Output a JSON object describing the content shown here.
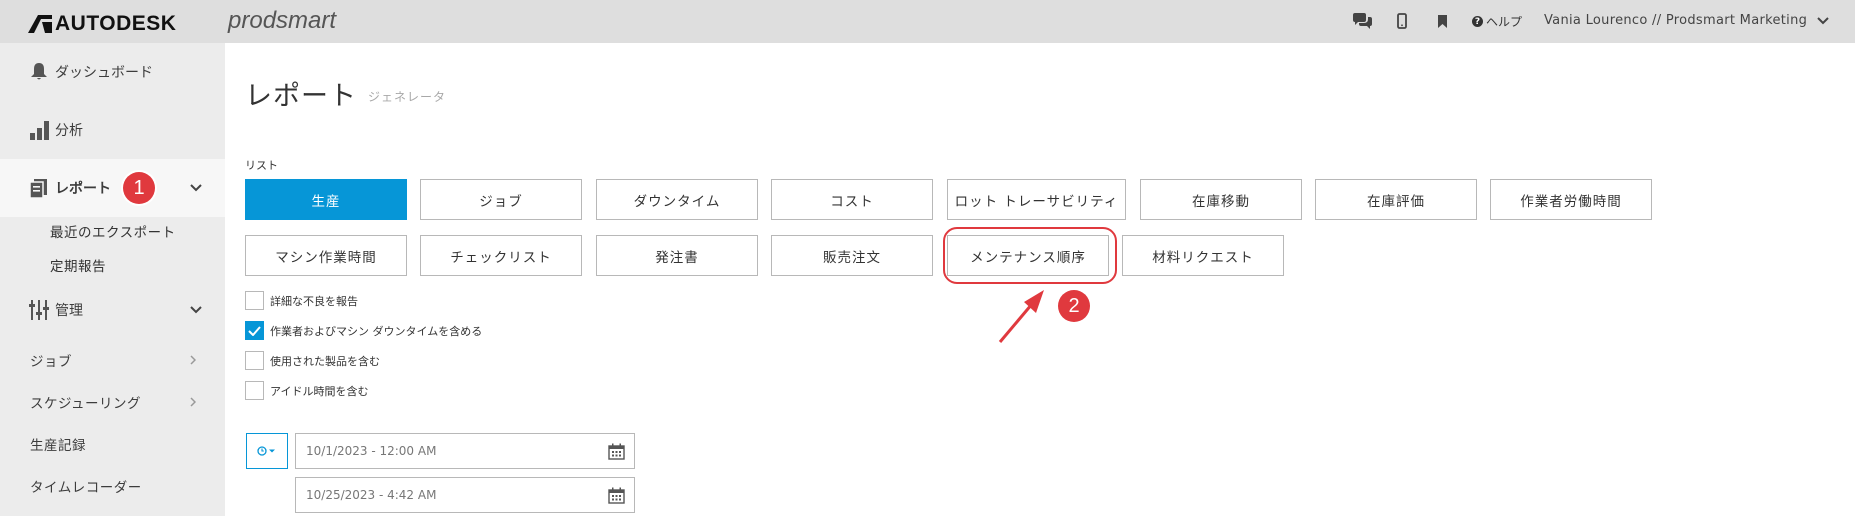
{
  "topbar": {
    "brand": "AUTODESK",
    "product": "prodsmart",
    "help_label": "ヘルプ",
    "user_label": "Vania Lourenco // Prodsmart Marketing",
    "icons": [
      "chat-icon",
      "mobile-icon",
      "bookmark-icon",
      "help-icon",
      "chevron-down-icon"
    ]
  },
  "sidebar": {
    "dashboard": "ダッシュボード",
    "analysis": "分析",
    "reports": "レポート",
    "reports_badge": "1",
    "recent_exports": "最近のエクスポート",
    "scheduled_reports": "定期報告",
    "management": "管理",
    "jobs": "ジョブ",
    "scheduling": "スケジューリング",
    "production_records": "生産記録",
    "time_recorder": "タイムレコーダー"
  },
  "main": {
    "title": "レポート",
    "subtitle": "ジェネレータ",
    "list_label": "リスト",
    "report_buttons_row1": [
      "生産",
      "ジョブ",
      "ダウンタイム",
      "コスト",
      "ロット トレーサビリティ",
      "在庫移動",
      "在庫評価",
      "作業者労働時間"
    ],
    "report_buttons_row2": [
      "マシン作業時間",
      "チェックリスト",
      "発注書",
      "販売注文",
      "メンテナンス順序",
      "材料リクエスト"
    ],
    "active_report": "生産",
    "callout_badge": "2",
    "options": [
      {
        "label": "詳細な不良を報告",
        "checked": false
      },
      {
        "label": "作業者およびマシン ダウンタイムを含める",
        "checked": true
      },
      {
        "label": "使用された製品を含む",
        "checked": false
      },
      {
        "label": "アイドル時間を含む",
        "checked": false
      }
    ],
    "date_start": "10/1/2023 - 12:00 AM",
    "date_end": "10/25/2023 - 4:42 AM"
  },
  "colors": {
    "accent": "#0696d7",
    "annotation": "#e0393e",
    "topbar_bg": "#dedede",
    "sidebar_bg": "#ececec"
  }
}
